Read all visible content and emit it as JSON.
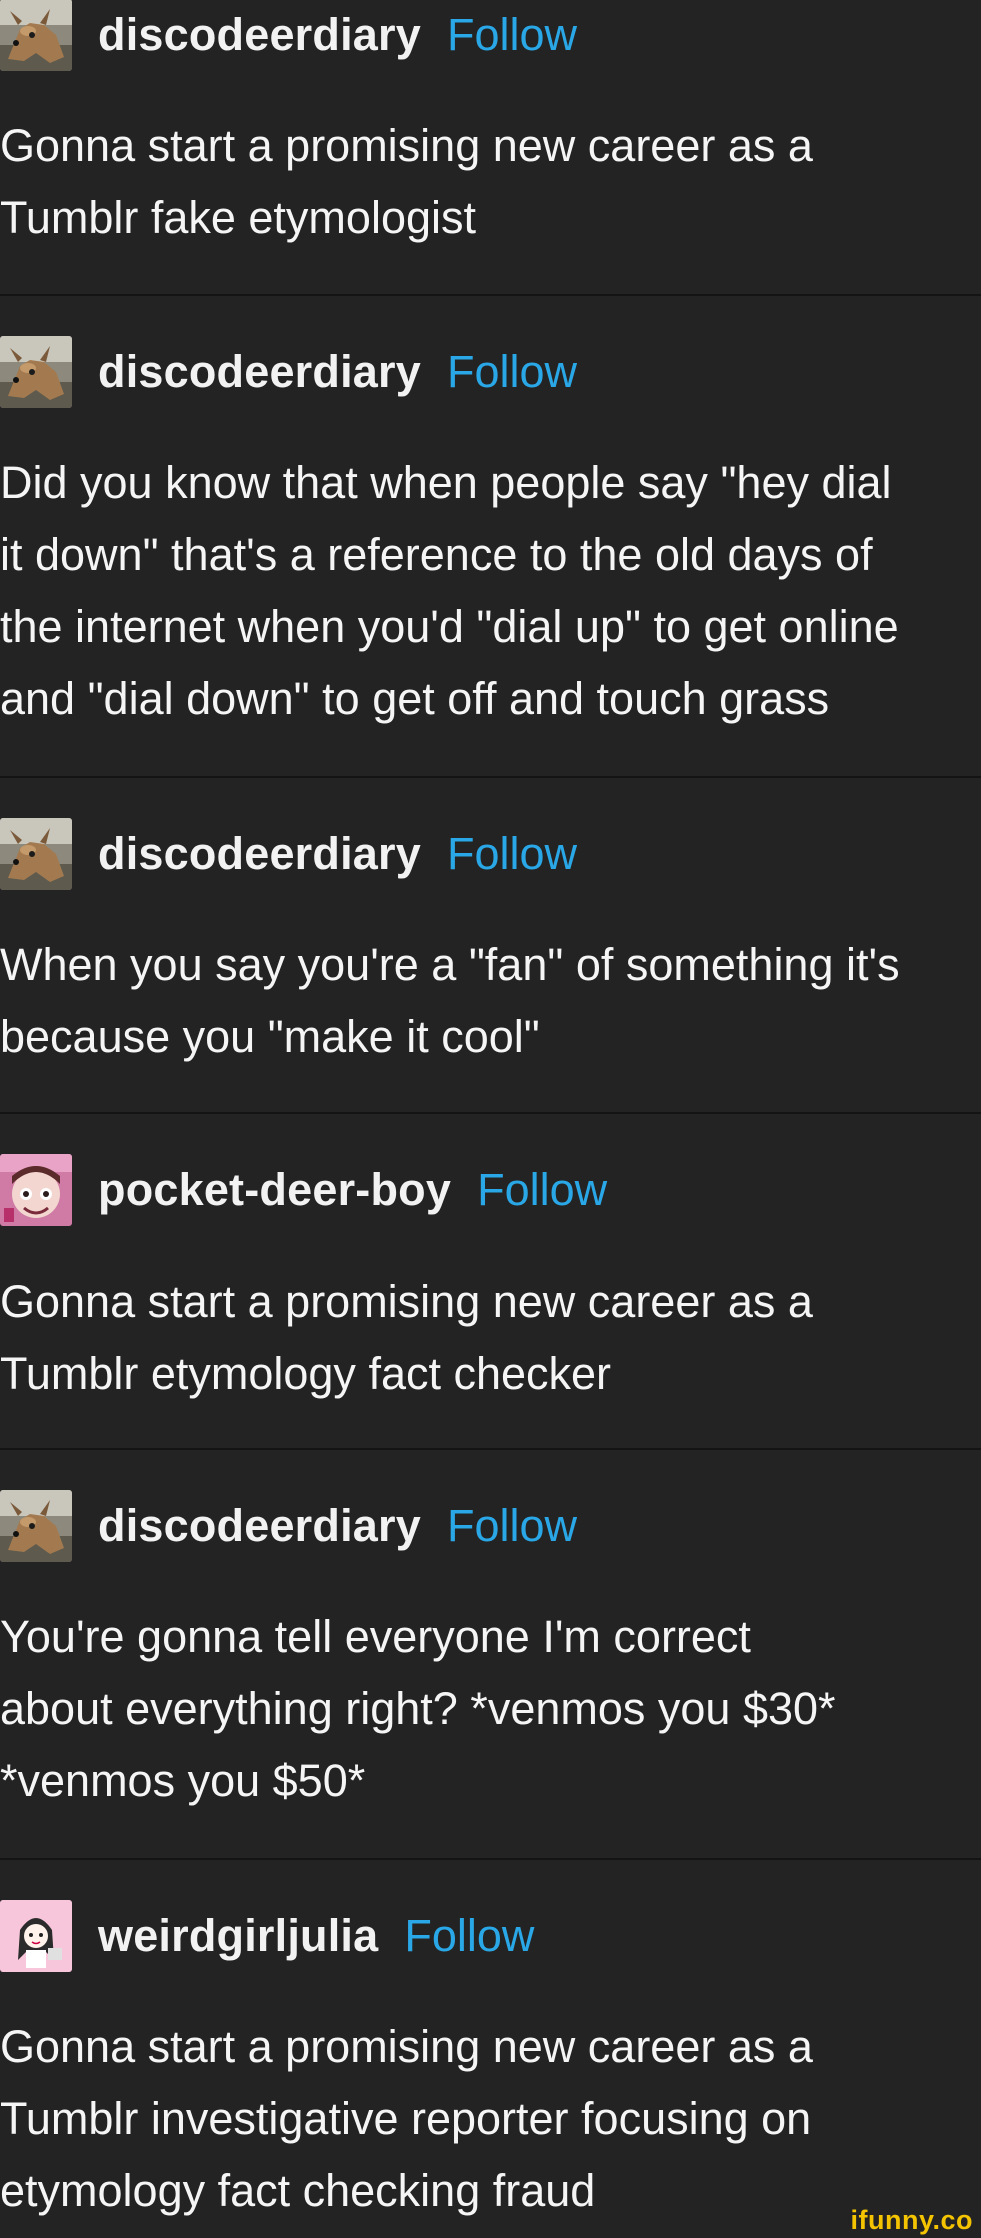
{
  "follow_label": "Follow",
  "colors": {
    "background": "#232323",
    "divider": "#141414",
    "follow": "#2aa7e6",
    "watermark": "#f4c400"
  },
  "posts": [
    {
      "username": "discodeerdiary",
      "avatar_icon": "deer-photo-avatar",
      "text": "Gonna start a promising new career as a\nTumblr fake etymologist"
    },
    {
      "username": "discodeerdiary",
      "avatar_icon": "deer-photo-avatar",
      "text": "Did you know that when people say \"hey dial\nit down\" that's a reference to the old days of\nthe internet when you'd \"dial up\" to get online\nand \"dial down\" to get off and touch grass"
    },
    {
      "username": "discodeerdiary",
      "avatar_icon": "deer-photo-avatar",
      "text": "When you say you're a \"fan\" of something it's\nbecause you \"make it cool\""
    },
    {
      "username": "pocket-deer-boy",
      "avatar_icon": "cartoon-character-avatar",
      "text": "Gonna start a promising new career as a\nTumblr etymology fact checker"
    },
    {
      "username": "discodeerdiary",
      "avatar_icon": "deer-photo-avatar",
      "text": "You're gonna tell everyone I'm correct\nabout everything right? *venmos you $30*\n*venmos you $50*"
    },
    {
      "username": "weirdgirljulia",
      "avatar_icon": "drawn-girl-avatar",
      "text": "Gonna start a promising new career as a\nTumblr investigative reporter focusing on\netymology fact checking fraud"
    }
  ],
  "watermark": "ifunny.co"
}
